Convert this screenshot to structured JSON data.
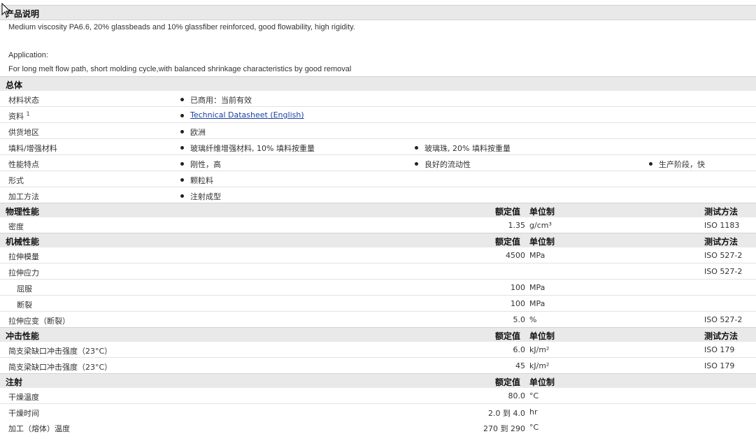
{
  "product_desc": {
    "title": "产品说明",
    "line1": "Medium viscosity PA6.6, 20% glassbeads and 10% glassfiber reinforced, good flowability, high rigidity.",
    "application_label": "Application:",
    "line2": "For long melt flow path, short molding cycle,with balanced shrinkage characteristics by good removal"
  },
  "general": {
    "title": "总体",
    "rows": [
      {
        "label": "材料状态",
        "values": [
          "已商用：当前有效"
        ]
      },
      {
        "label": "资料",
        "sup": "1",
        "values": [
          "Technical Datasheet (English)"
        ]
      },
      {
        "label": "供货地区",
        "values": [
          "欧洲"
        ]
      },
      {
        "label": "填料/增强材料",
        "values": [
          "玻璃纤维增强材料, 10% 填料按重量",
          "玻璃珠, 20% 填料按重量"
        ]
      },
      {
        "label": "性能特点",
        "values": [
          "刚性，高",
          "良好的流动性",
          "生产阶段，快"
        ]
      },
      {
        "label": "形式",
        "values": [
          "颗粒料"
        ]
      },
      {
        "label": "加工方法",
        "values": [
          "注射成型"
        ]
      }
    ]
  },
  "column_headers": {
    "nominal": "额定值",
    "unit": "单位制",
    "test": "测试方法"
  },
  "physical": {
    "title": "物理性能",
    "rows": [
      {
        "label": "密度",
        "value": "1.35",
        "unit": "g/cm³",
        "test": "ISO 1183"
      }
    ]
  },
  "mechanical": {
    "title": "机械性能",
    "rows": [
      {
        "label": "拉伸模量",
        "value": "4500",
        "unit": "MPa",
        "test": "ISO 527-2"
      },
      {
        "label": "拉伸应力",
        "value": "",
        "unit": "",
        "test": "ISO 527-2"
      },
      {
        "label": "屈服",
        "value": "100",
        "unit": "MPa",
        "test": ""
      },
      {
        "label": "断裂",
        "value": "100",
        "unit": "MPa",
        "test": ""
      },
      {
        "label": "拉伸应变（断裂）",
        "value": "5.0",
        "unit": "%",
        "test": "ISO 527-2"
      }
    ]
  },
  "impact": {
    "title": "冲击性能",
    "rows": [
      {
        "label": "简支梁缺口冲击强度（23°C）",
        "value": "6.0",
        "unit": "kJ/m²",
        "test": "ISO 179"
      },
      {
        "label": "简支梁缺口冲击强度（23°C）",
        "value": "45",
        "unit": "kJ/m²",
        "test": "ISO 179"
      }
    ]
  },
  "injection": {
    "title": "注射",
    "rows": [
      {
        "label": "干燥温度",
        "value": "80.0",
        "unit": "°C"
      },
      {
        "label": "干燥时间",
        "value": "2.0 到  4.0",
        "unit": "hr"
      },
      {
        "label": "加工（熔体）温度",
        "value": "270 到  290",
        "unit": "°C"
      }
    ]
  }
}
